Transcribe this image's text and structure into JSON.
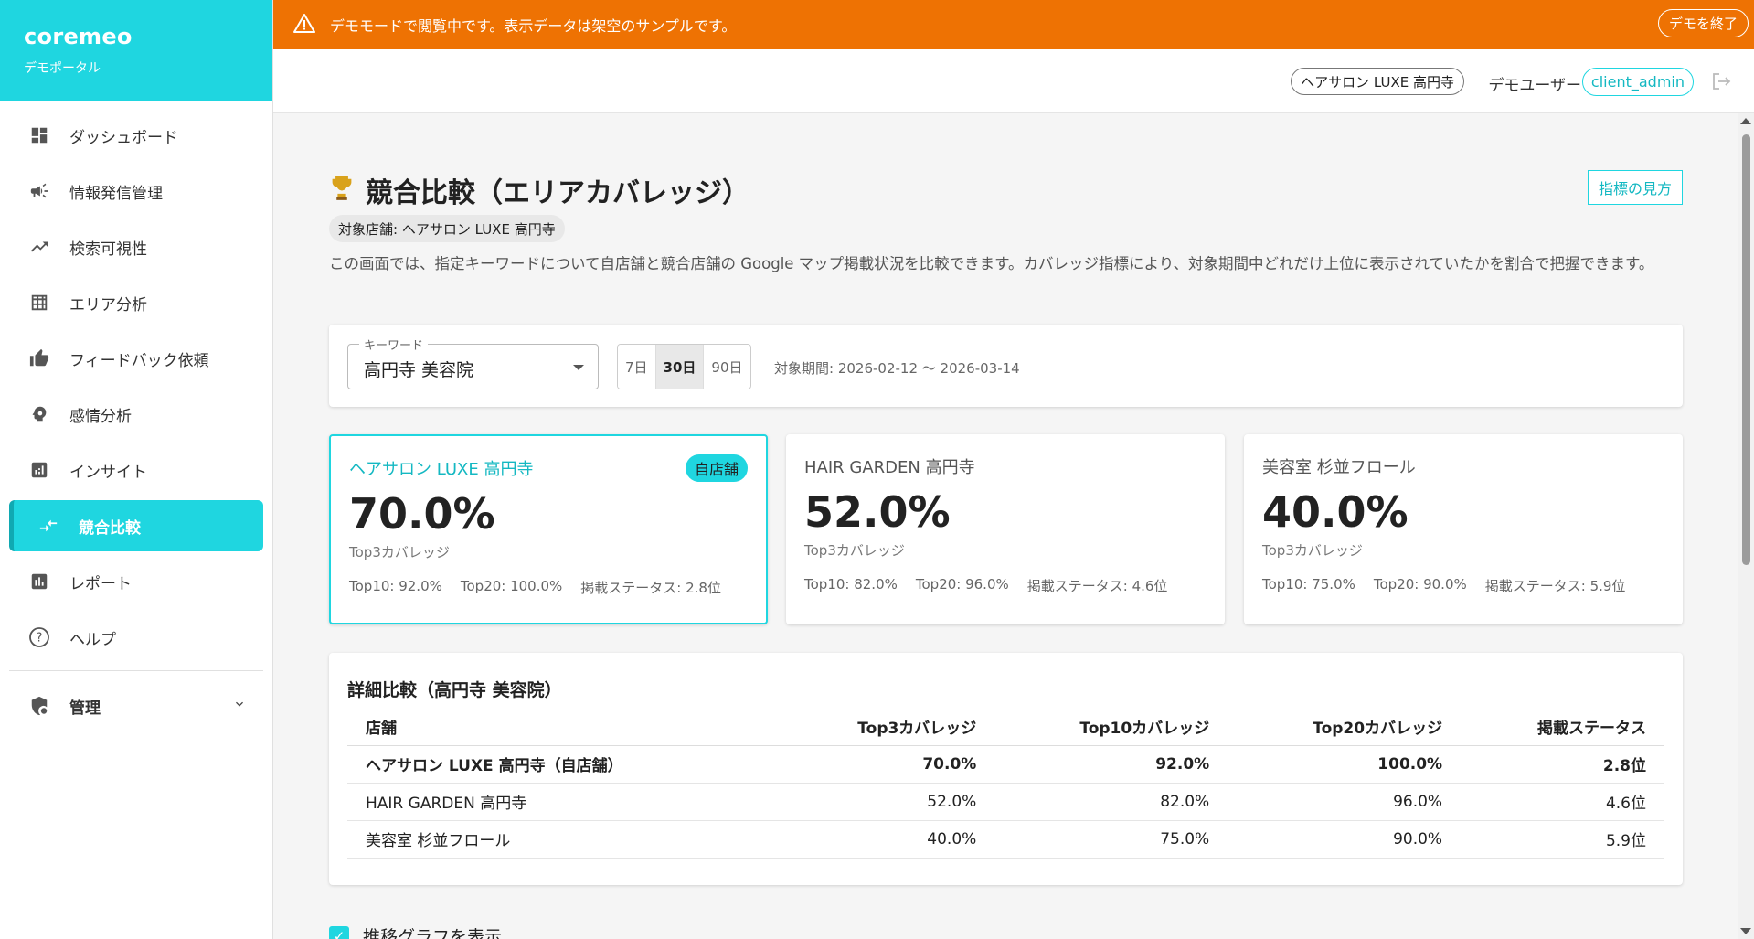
{
  "brand": {
    "name": "coremeo",
    "subtitle": "デモポータル"
  },
  "sidebar": {
    "items": [
      {
        "label": "ダッシュボード",
        "icon": "dashboard-icon"
      },
      {
        "label": "情報発信管理",
        "icon": "megaphone-icon"
      },
      {
        "label": "検索可視性",
        "icon": "trending-up-icon"
      },
      {
        "label": "エリア分析",
        "icon": "grid-icon"
      },
      {
        "label": "フィードバック依頼",
        "icon": "thumb-up-icon"
      },
      {
        "label": "感情分析",
        "icon": "psychology-icon"
      },
      {
        "label": "インサイト",
        "icon": "insights-icon"
      },
      {
        "label": "競合比較",
        "icon": "compare-arrows-icon",
        "active": true
      },
      {
        "label": "レポート",
        "icon": "bar-chart-icon"
      },
      {
        "label": "ヘルプ",
        "icon": "help-icon"
      }
    ],
    "admin_label": "管理"
  },
  "banner": {
    "message": "デモモードで閲覧中です。表示データは架空のサンプルです。",
    "exit_label": "デモを終了",
    "color": "#ee7203"
  },
  "header": {
    "store": "ヘアサロン LUXE 高円寺",
    "user": "デモユーザー",
    "role": "client_admin"
  },
  "page": {
    "title": "競合比較（エリアカバレッジ）",
    "help_label": "指標の見方",
    "target_store": "対象店舗: ヘアサロン LUXE 高円寺",
    "description": "この画面では、指定キーワードについて自店舗と競合店舗の Google マップ掲載状況を比較できます。カバレッジ指標により、対象期間中どれだけ上位に表示されていたかを割合で把握できます。"
  },
  "filter": {
    "keyword_label": "キーワード",
    "keyword_value": "高円寺 美容院",
    "ranges": [
      "7日",
      "30日",
      "90日"
    ],
    "selected_range": "30日",
    "period": "対象期間: 2026-02-12 〜 2026-03-14"
  },
  "cards": [
    {
      "name": "ヘアサロン LUXE 高円寺",
      "badge": "自店舗",
      "value": "70.0%",
      "label": "Top3カバレッジ",
      "top10": "Top10: 92.0%",
      "top20": "Top20: 100.0%",
      "status": "掲載ステータス: 2.8位"
    },
    {
      "name": "HAIR GARDEN 高円寺",
      "value": "52.0%",
      "label": "Top3カバレッジ",
      "top10": "Top10: 82.0%",
      "top20": "Top20: 96.0%",
      "status": "掲載ステータス: 4.6位"
    },
    {
      "name": "美容室 杉並フロール",
      "value": "40.0%",
      "label": "Top3カバレッジ",
      "top10": "Top10: 75.0%",
      "top20": "Top20: 90.0%",
      "status": "掲載ステータス: 5.9位"
    }
  ],
  "detail": {
    "title": "詳細比較（高円寺 美容院）",
    "columns": [
      "店舗",
      "Top3カバレッジ",
      "Top10カバレッジ",
      "Top20カバレッジ",
      "掲載ステータス"
    ],
    "rows": [
      [
        "ヘアサロン LUXE 高円寺（自店舗）",
        "70.0%",
        "92.0%",
        "100.0%",
        "2.8位"
      ],
      [
        "HAIR GARDEN 高円寺",
        "52.0%",
        "82.0%",
        "96.0%",
        "4.6位"
      ],
      [
        "美容室 杉並フロール",
        "40.0%",
        "75.0%",
        "90.0%",
        "5.9位"
      ]
    ]
  },
  "chart_toggle": {
    "label": "推移グラフを表示",
    "checked": true
  },
  "colors": {
    "accent": "#1fd6e0",
    "banner": "#ee7203"
  }
}
